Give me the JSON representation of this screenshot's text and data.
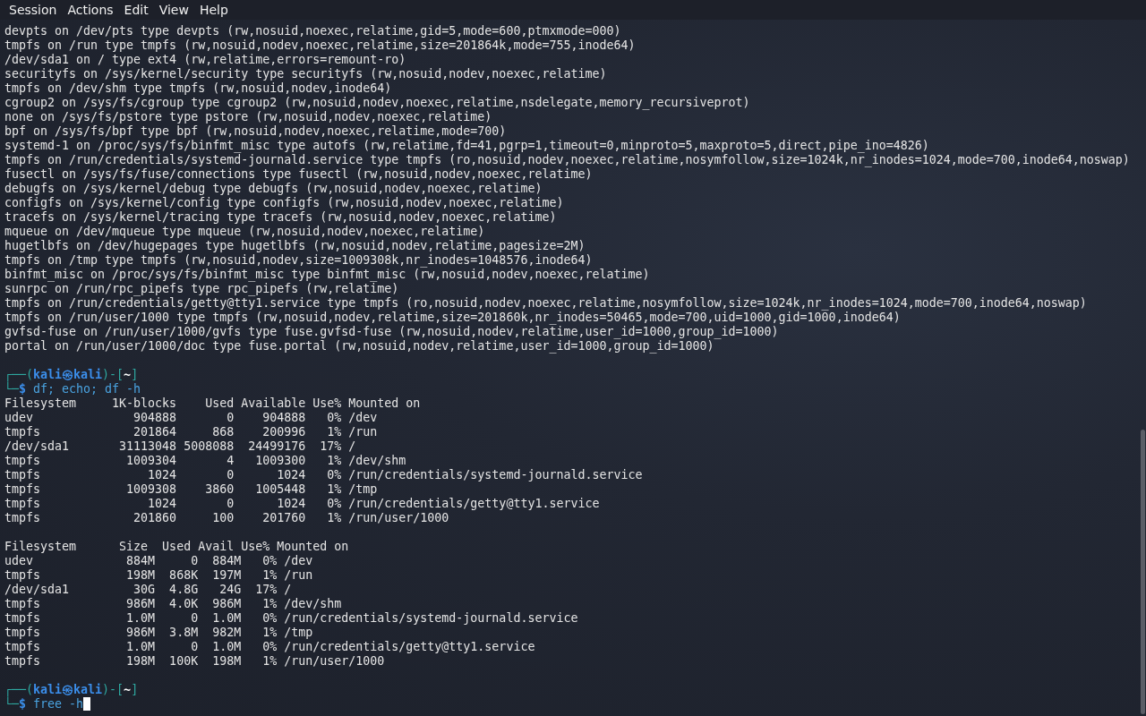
{
  "menu": [
    {
      "label": "Session"
    },
    {
      "label": "Actions"
    },
    {
      "label": "Edit"
    },
    {
      "label": "View"
    },
    {
      "label": "Help"
    }
  ],
  "terminal": {
    "lines": [
      {
        "kind": "output",
        "text": "devpts on /dev/pts type devpts (rw,nosuid,noexec,relatime,gid=5,mode=600,ptmxmode=000)"
      },
      {
        "kind": "output",
        "text": "tmpfs on /run type tmpfs (rw,nosuid,nodev,noexec,relatime,size=201864k,mode=755,inode64)"
      },
      {
        "kind": "output",
        "text": "/dev/sda1 on / type ext4 (rw,relatime,errors=remount-ro)"
      },
      {
        "kind": "output",
        "text": "securityfs on /sys/kernel/security type securityfs (rw,nosuid,nodev,noexec,relatime)"
      },
      {
        "kind": "output",
        "text": "tmpfs on /dev/shm type tmpfs (rw,nosuid,nodev,inode64)"
      },
      {
        "kind": "output",
        "text": "cgroup2 on /sys/fs/cgroup type cgroup2 (rw,nosuid,nodev,noexec,relatime,nsdelegate,memory_recursiveprot)"
      },
      {
        "kind": "output",
        "text": "none on /sys/fs/pstore type pstore (rw,nosuid,nodev,noexec,relatime)"
      },
      {
        "kind": "output",
        "text": "bpf on /sys/fs/bpf type bpf (rw,nosuid,nodev,noexec,relatime,mode=700)"
      },
      {
        "kind": "output",
        "text": "systemd-1 on /proc/sys/fs/binfmt_misc type autofs (rw,relatime,fd=41,pgrp=1,timeout=0,minproto=5,maxproto=5,direct,pipe_ino=4826)"
      },
      {
        "kind": "output",
        "text": "tmpfs on /run/credentials/systemd-journald.service type tmpfs (ro,nosuid,nodev,noexec,relatime,nosymfollow,size=1024k,nr_inodes=1024,mode=700,inode64,noswap)"
      },
      {
        "kind": "output",
        "text": "fusectl on /sys/fs/fuse/connections type fusectl (rw,nosuid,nodev,noexec,relatime)"
      },
      {
        "kind": "output",
        "text": "debugfs on /sys/kernel/debug type debugfs (rw,nosuid,nodev,noexec,relatime)"
      },
      {
        "kind": "output",
        "text": "configfs on /sys/kernel/config type configfs (rw,nosuid,nodev,noexec,relatime)"
      },
      {
        "kind": "output",
        "text": "tracefs on /sys/kernel/tracing type tracefs (rw,nosuid,nodev,noexec,relatime)"
      },
      {
        "kind": "output",
        "text": "mqueue on /dev/mqueue type mqueue (rw,nosuid,nodev,noexec,relatime)"
      },
      {
        "kind": "output",
        "text": "hugetlbfs on /dev/hugepages type hugetlbfs (rw,nosuid,nodev,relatime,pagesize=2M)"
      },
      {
        "kind": "output",
        "text": "tmpfs on /tmp type tmpfs (rw,nosuid,nodev,size=1009308k,nr_inodes=1048576,inode64)"
      },
      {
        "kind": "output",
        "text": "binfmt_misc on /proc/sys/fs/binfmt_misc type binfmt_misc (rw,nosuid,nodev,noexec,relatime)"
      },
      {
        "kind": "output",
        "text": "sunrpc on /run/rpc_pipefs type rpc_pipefs (rw,relatime)"
      },
      {
        "kind": "output",
        "text": "tmpfs on /run/credentials/getty@tty1.service type tmpfs (ro,nosuid,nodev,noexec,relatime,nosymfollow,size=1024k,nr_inodes=1024,mode=700,inode64,noswap)"
      },
      {
        "kind": "output",
        "text": "tmpfs on /run/user/1000 type tmpfs (rw,nosuid,nodev,relatime,size=201860k,nr_inodes=50465,mode=700,uid=1000,gid=1000,inode64)"
      },
      {
        "kind": "output",
        "text": "gvfsd-fuse on /run/user/1000/gvfs type fuse.gvfsd-fuse (rw,nosuid,nodev,relatime,user_id=1000,group_id=1000)"
      },
      {
        "kind": "output",
        "text": "portal on /run/user/1000/doc type fuse.portal (rw,nosuid,nodev,relatime,user_id=1000,group_id=1000)"
      },
      {
        "kind": "blank"
      },
      {
        "kind": "prompt",
        "corner_top": "┌──(",
        "user_host": "kali㉿kali",
        "bracket_mid": ")-[",
        "cwd": "~",
        "bracket_end": "]",
        "corner_bottom": "└─",
        "symbol": "$",
        "command": "df; echo; df -h",
        "cursor": false
      },
      {
        "kind": "output",
        "text": "Filesystem     1K-blocks    Used Available Use% Mounted on"
      },
      {
        "kind": "output",
        "text": "udev              904888       0    904888   0% /dev"
      },
      {
        "kind": "output",
        "text": "tmpfs             201864     868    200996   1% /run"
      },
      {
        "kind": "output",
        "text": "/dev/sda1       31113048 5008088  24499176  17% /"
      },
      {
        "kind": "output",
        "text": "tmpfs            1009304       4   1009300   1% /dev/shm"
      },
      {
        "kind": "output",
        "text": "tmpfs               1024       0      1024   0% /run/credentials/systemd-journald.service"
      },
      {
        "kind": "output",
        "text": "tmpfs            1009308    3860   1005448   1% /tmp"
      },
      {
        "kind": "output",
        "text": "tmpfs               1024       0      1024   0% /run/credentials/getty@tty1.service"
      },
      {
        "kind": "output",
        "text": "tmpfs             201860     100    201760   1% /run/user/1000"
      },
      {
        "kind": "blank"
      },
      {
        "kind": "output",
        "text": "Filesystem      Size  Used Avail Use% Mounted on"
      },
      {
        "kind": "output",
        "text": "udev             884M     0  884M   0% /dev"
      },
      {
        "kind": "output",
        "text": "tmpfs            198M  868K  197M   1% /run"
      },
      {
        "kind": "output",
        "text": "/dev/sda1         30G  4.8G   24G  17% /"
      },
      {
        "kind": "output",
        "text": "tmpfs            986M  4.0K  986M   1% /dev/shm"
      },
      {
        "kind": "output",
        "text": "tmpfs            1.0M     0  1.0M   0% /run/credentials/systemd-journald.service"
      },
      {
        "kind": "output",
        "text": "tmpfs            986M  3.8M  982M   1% /tmp"
      },
      {
        "kind": "output",
        "text": "tmpfs            1.0M     0  1.0M   0% /run/credentials/getty@tty1.service"
      },
      {
        "kind": "output",
        "text": "tmpfs            198M  100K  198M   1% /run/user/1000"
      },
      {
        "kind": "blank"
      },
      {
        "kind": "prompt",
        "corner_top": "┌──(",
        "user_host": "kali㉿kali",
        "bracket_mid": ")-[",
        "cwd": "~",
        "bracket_end": "]",
        "corner_bottom": "└─",
        "symbol": "$",
        "command": "free -h",
        "cursor": true
      }
    ]
  }
}
